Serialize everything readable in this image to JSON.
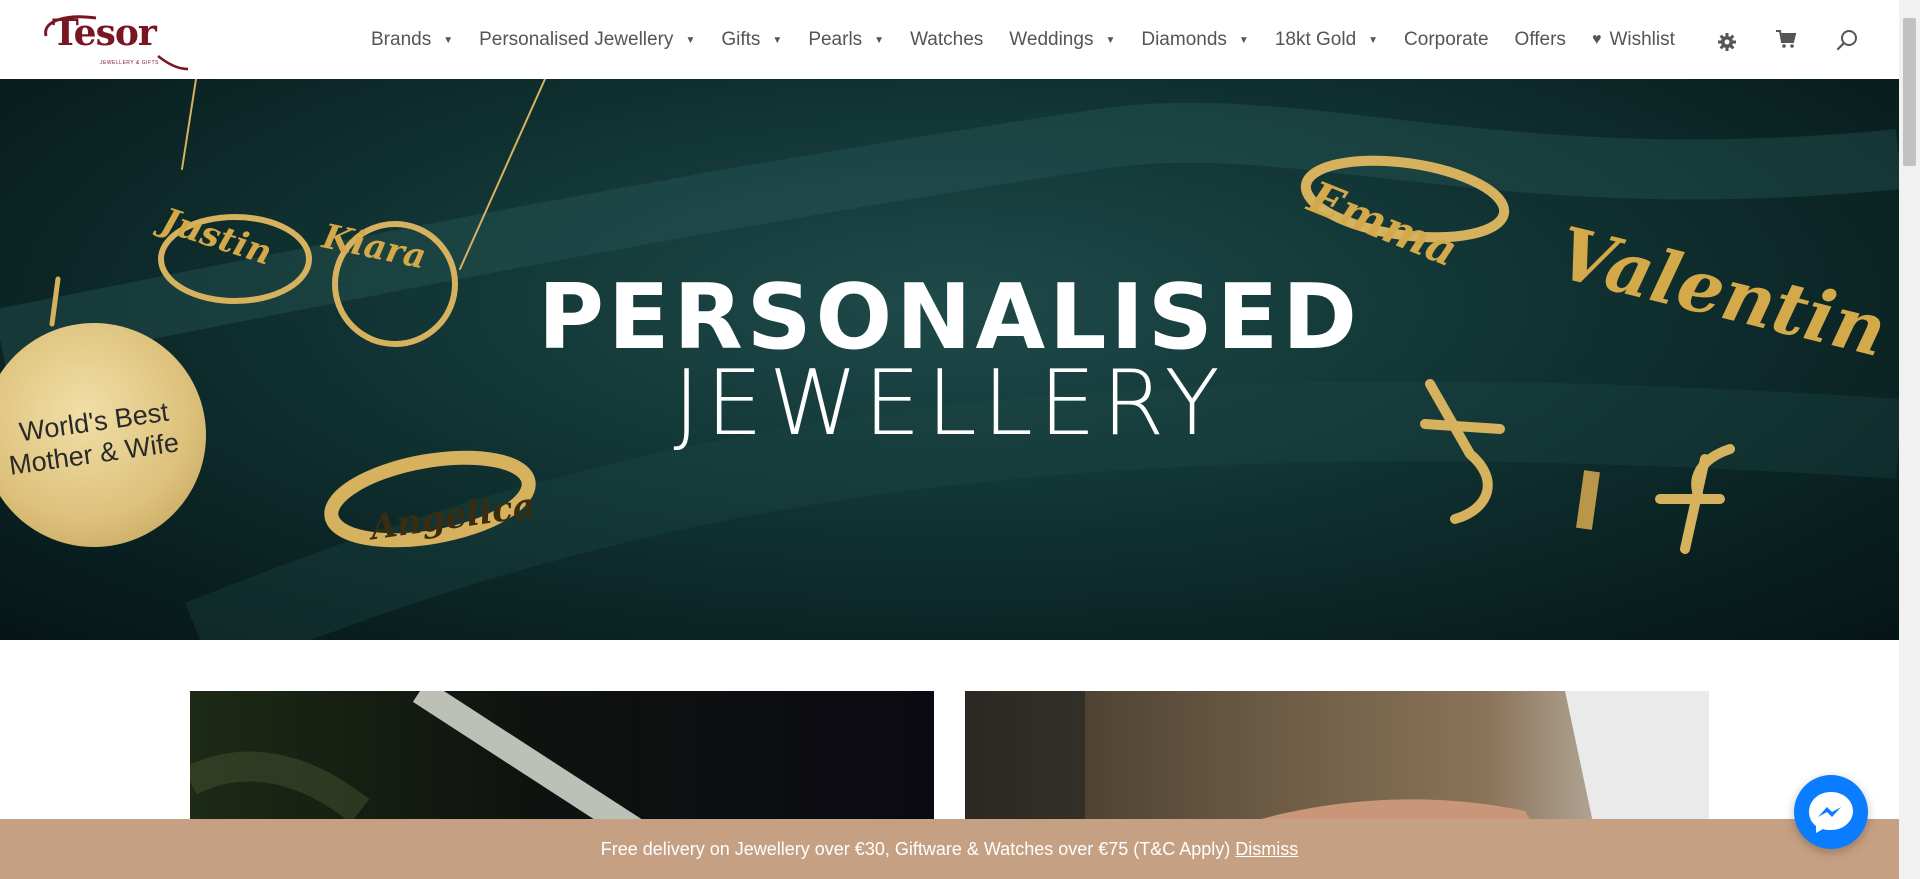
{
  "header": {
    "logo": {
      "name": "Tesor",
      "tagline": "JEWELLERY & GIFTS"
    },
    "nav": [
      {
        "label": "Brands",
        "dropdown": true
      },
      {
        "label": "Personalised Jewellery",
        "dropdown": true
      },
      {
        "label": "Gifts",
        "dropdown": true
      },
      {
        "label": "Pearls",
        "dropdown": true
      },
      {
        "label": "Watches",
        "dropdown": false
      },
      {
        "label": "Weddings",
        "dropdown": true
      },
      {
        "label": "Diamonds",
        "dropdown": true
      },
      {
        "label": "18kt Gold",
        "dropdown": true
      },
      {
        "label": "Corporate",
        "dropdown": false
      },
      {
        "label": "Offers",
        "dropdown": false
      },
      {
        "label": "Wishlist",
        "dropdown": false
      }
    ],
    "icons": [
      "gear-icon",
      "cart-icon",
      "search-icon"
    ]
  },
  "hero": {
    "line1": "PERSONALISED",
    "line2": "JEWELLERY",
    "engravings": {
      "necklace_left": "Justin",
      "necklace_right": "Kiara",
      "pendant_line1": "World's Best",
      "pendant_line2": "Mother & Wife",
      "ring_bottom": "Angelica",
      "ring_top": "Emma",
      "nameplate": "Valentin"
    }
  },
  "notice": {
    "text": "Free delivery on Jewellery over €30, Giftware & Watches over €75 (T&C Apply)",
    "dismiss": "Dismiss"
  },
  "colors": {
    "brand": "#7a1522",
    "notice_bg": "#c6a083",
    "hero_bg": "#123535",
    "gold": "#d6b25e",
    "messenger": "#0a7cff"
  }
}
